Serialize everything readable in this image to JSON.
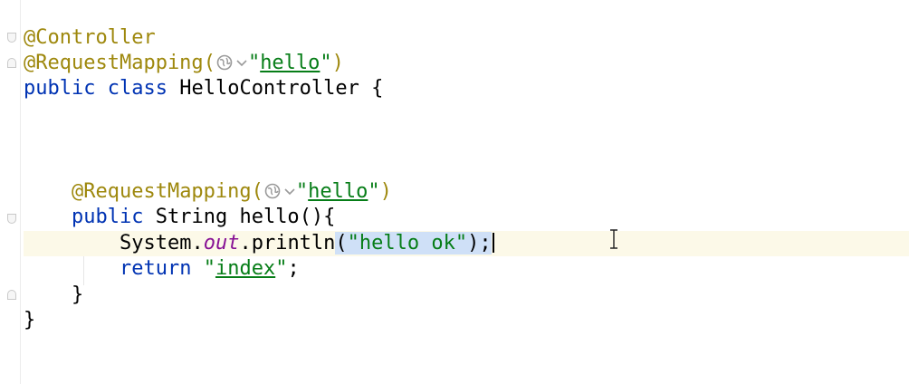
{
  "code": {
    "class_annotation": "@Controller",
    "class_mapping_annotation": "@RequestMapping",
    "class_mapping_path": "hello",
    "public_kw": "public",
    "class_kw": "class",
    "class_name": "HelloController",
    "open_brace": "{",
    "close_brace": "}",
    "method_mapping_annotation": "@RequestMapping",
    "method_mapping_path": "hello",
    "return_type": "String",
    "method_name": "hello",
    "method_sig_tail": "(){",
    "system": "System",
    "out_field": "out",
    "println": "println",
    "println_arg": "\"hello ok\"",
    "return_kw": "return",
    "return_value": "index",
    "semicolon": ";"
  },
  "icons": {
    "globe": "globe-icon",
    "chevron": "chevron-down-icon"
  },
  "colors": {
    "annotation": "#9e880d",
    "keyword": "#0033b3",
    "string": "#067d17",
    "field": "#871094",
    "selection": "#cfe0f7",
    "current_line": "#fcf9e8"
  }
}
